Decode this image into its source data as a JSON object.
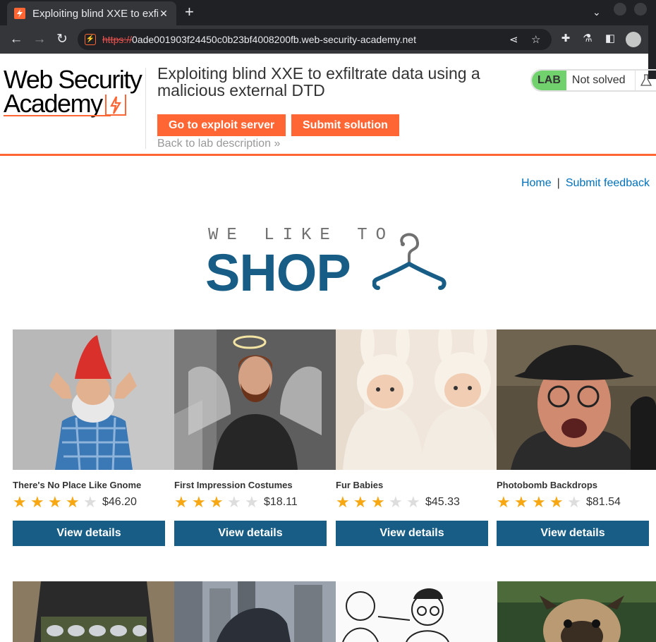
{
  "browser": {
    "tab_title": "Exploiting blind XXE to exfiltrate data using a malicious external DTD",
    "url_scheme": "https://",
    "url_host": "0ade001903f24450c0b23bf4008200fb.web-security-academy.net"
  },
  "logo": {
    "line1": "Web Security",
    "line2": "Academy"
  },
  "lab": {
    "title": "Exploiting blind XXE to exfiltrate data using a malicious external DTD",
    "exploit_button": "Go to exploit server",
    "submit_button": "Submit solution",
    "back_link": "Back to lab description",
    "badge": "LAB",
    "status": "Not solved"
  },
  "nav": {
    "home": "Home",
    "separator": "|",
    "feedback": "Submit feedback"
  },
  "banner": {
    "tagline": "WE LIKE TO",
    "word": "SHOP"
  },
  "colors": {
    "accent": "#ff6633",
    "primary": "#185d85",
    "star": "#f7a712",
    "lab_green": "#70d16d",
    "link": "#0071bc"
  },
  "products": [
    {
      "name": "There's No Place Like Gnome",
      "rating": 4,
      "price": "$46.20",
      "button": "View details"
    },
    {
      "name": "First Impression Costumes",
      "rating": 3,
      "price": "$18.11",
      "button": "View details"
    },
    {
      "name": "Fur Babies",
      "rating": 3,
      "price": "$45.33",
      "button": "View details"
    },
    {
      "name": "Photobomb Backdrops",
      "rating": 4,
      "price": "$81.54",
      "button": "View details"
    }
  ]
}
